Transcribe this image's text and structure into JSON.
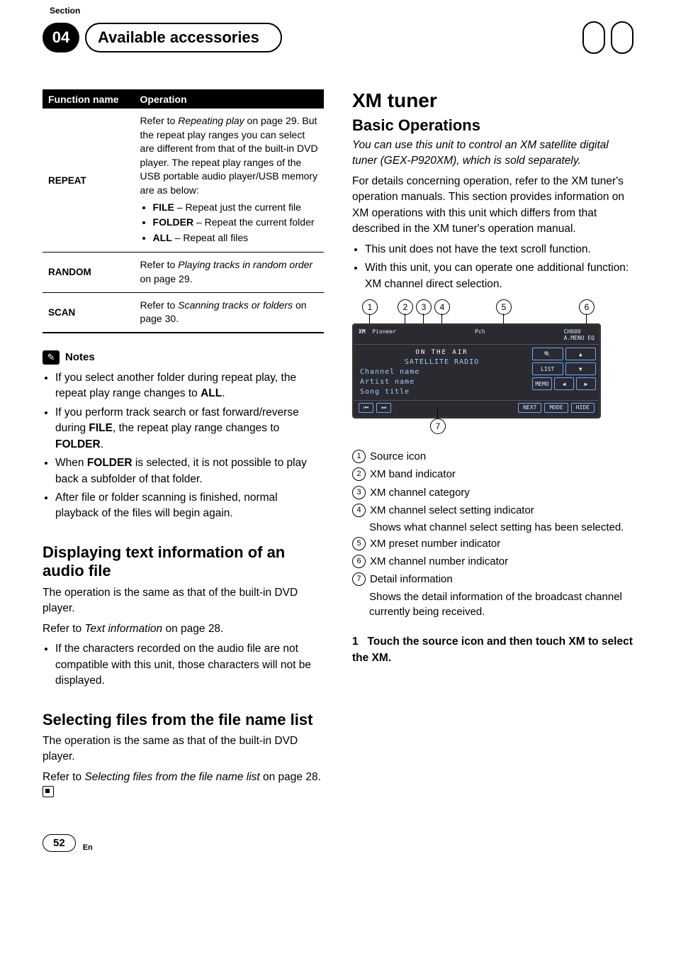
{
  "header": {
    "section_label": "Section",
    "number": "04",
    "title": "Available accessories"
  },
  "table": {
    "head_name": "Function name",
    "head_op": "Operation",
    "repeat": {
      "name": "REPEAT",
      "lead_a": "Refer to ",
      "lead_i": "Repeating play",
      "lead_b": " on page 29. But the repeat play ranges you can select are different from that of the built-in DVD player. The repeat play ranges of the USB portable audio player/USB memory are as below:",
      "b1a": "FILE",
      "b1b": " – Repeat just the current file",
      "b2a": "FOLDER",
      "b2b": " – Repeat the current folder",
      "b3a": "ALL",
      "b3b": " – Repeat all files"
    },
    "random": {
      "name": "RANDOM",
      "a": "Refer to ",
      "i": "Playing tracks in random order",
      "b": " on page 29."
    },
    "scan": {
      "name": "SCAN",
      "a": "Refer to ",
      "i": "Scanning tracks or folders",
      "b": " on page 30."
    }
  },
  "notes": {
    "head": "Notes",
    "n1a": "If you select another folder during repeat play, the repeat play range changes to ",
    "n1b": "ALL",
    "n1c": ".",
    "n2a": "If you perform track search or fast forward/reverse during ",
    "n2b": "FILE",
    "n2c": ", the repeat play range changes to ",
    "n2d": "FOLDER",
    "n2e": ".",
    "n3a": "When ",
    "n3b": "FOLDER",
    "n3c": " is selected, it is not possible to play back a subfolder of that folder.",
    "n4": "After file or folder scanning is finished, normal playback of the files will begin again."
  },
  "disp": {
    "title": "Displaying text information of an audio file",
    "p1": "The operation is the same as that of the built-in DVD player.",
    "p2a": "Refer to ",
    "p2i": "Text information",
    "p2b": " on page 28.",
    "b1": "If the characters recorded on the audio file are not compatible with this unit, those characters will not be displayed."
  },
  "select": {
    "title": "Selecting files from the file name list",
    "p1": "The operation is the same as that of the built-in DVD player.",
    "p2a": "Refer to ",
    "p2i": "Selecting files from the file name list",
    "p2b": " on page 28."
  },
  "xm": {
    "title": "XM tuner",
    "basic": "Basic Operations",
    "intro_i": "You can use this unit to control an XM satellite digital tuner (GEX-P920XM), which is sold separately.",
    "intro_p": "For details concerning operation, refer to the XM tuner's operation manuals. This section provides information on XM operations with this unit which differs from that described in the XM tuner's operation manual.",
    "b1": "This unit does not have the text scroll function.",
    "b2": "With this unit, you can operate one additional function: XM channel direct selection."
  },
  "screen": {
    "xm": "XM",
    "pioneer": "Pioneer",
    "pch": "Pch",
    "ch_num": "CH000",
    "menu": "A.MENU",
    "eq": "EQ",
    "air": "ON THE AIR",
    "sat": "SATELLITE RADIO",
    "l1": "Channel name",
    "l2": "Artist name",
    "l3": "Song title",
    "btn_list": "LIST",
    "btn_memo": "MEMO",
    "btn_next": "NEXT",
    "btn_mode": "MODE",
    "btn_hide": "HIDE"
  },
  "legend": {
    "l1": "Source icon",
    "l2": "XM band indicator",
    "l3": "XM channel category",
    "l4": "XM channel select setting indicator",
    "l4s": "Shows what channel select setting has been selected.",
    "l5": "XM preset number indicator",
    "l6": "XM channel number indicator",
    "l7": "Detail information",
    "l7s": "Shows the detail information of the broadcast channel currently being received."
  },
  "step": {
    "num": "1",
    "text": "Touch the source icon and then touch XM to select the XM."
  },
  "footer": {
    "page": "52",
    "lang": "En"
  },
  "chart_data": {
    "type": "table",
    "title": "Function name / Operation",
    "columns": [
      "Function name",
      "Operation"
    ],
    "rows": [
      [
        "REPEAT",
        "Refer to Repeating play on page 29. But the repeat play ranges you can select are different from that of the built-in DVD player. The repeat play ranges of the USB portable audio player/USB memory are as below: FILE – Repeat just the current file; FOLDER – Repeat the current folder; ALL – Repeat all files"
      ],
      [
        "RANDOM",
        "Refer to Playing tracks in random order on page 29."
      ],
      [
        "SCAN",
        "Refer to Scanning tracks or folders on page 30."
      ]
    ]
  }
}
